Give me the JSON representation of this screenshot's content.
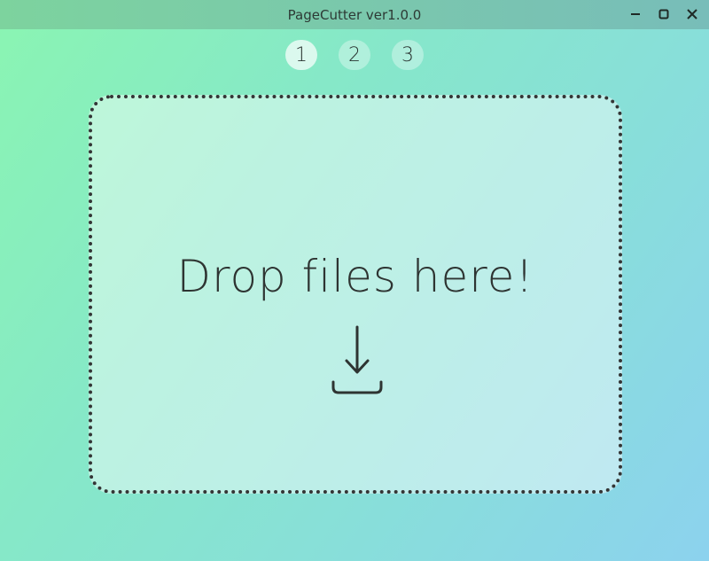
{
  "window": {
    "title": "PageCutter ver1.0.0"
  },
  "controls": {
    "minimize_icon": "minimize-icon",
    "maximize_icon": "maximize-icon",
    "close_icon": "close-icon"
  },
  "steps": [
    {
      "label": "1",
      "active": true
    },
    {
      "label": "2",
      "active": false
    },
    {
      "label": "3",
      "active": false
    }
  ],
  "dropzone": {
    "text": "Drop files here!",
    "icon": "download-tray-icon"
  },
  "colors": {
    "text": "#2e3432",
    "border": "#333535"
  }
}
